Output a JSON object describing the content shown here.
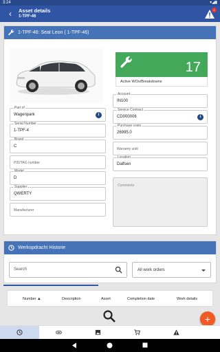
{
  "status_bar": {
    "time": "3:24",
    "right_text": "▾◢▮"
  },
  "app_bar": {
    "back_icon": "back-arrow-icon",
    "title": "Asset details",
    "subtitle": "1-TPF-46",
    "warning_badge": "1"
  },
  "asset_card": {
    "header": "1-TPF-46: Seat Leon ( 1-TPF-46)",
    "open_workorders": {
      "count": "17",
      "label": "Active WOs/Breakdowns",
      "color": "#44a85a"
    },
    "left_fields": [
      {
        "label": "Part of",
        "value": "Wagenpark",
        "info": true
      },
      {
        "label": "Serial Number",
        "value": "1-TPF-4",
        "info": false
      },
      {
        "label": "Brand",
        "value": "C",
        "info": false
      },
      {
        "label": "",
        "value": "",
        "placeholder": "PID/TAG number",
        "info": false
      },
      {
        "label": "Model",
        "value": "D",
        "info": false
      },
      {
        "label": "Supplier",
        "value": "QWERTY",
        "info": false
      },
      {
        "label": "",
        "value": "",
        "placeholder": "Manufacturer",
        "info": false
      }
    ],
    "right_fields": [
      {
        "label": "Account",
        "value": "IN100",
        "info": false
      },
      {
        "label": "Service Contract",
        "value": "CD000006",
        "info": true
      },
      {
        "label": "Purchase costs",
        "value": "26995.0",
        "info": false
      },
      {
        "label": "",
        "value": "",
        "placeholder": "Warranty until",
        "info": false
      },
      {
        "label": "Location",
        "value": "Dalfsen",
        "info": false
      }
    ],
    "comments_placeholder": "Comments"
  },
  "history": {
    "header": "Werkopdracht Historie",
    "search_placeholder": "Search",
    "filter_value": "All work orders",
    "columns": [
      "Number ▲",
      "Description",
      "Asset",
      "Completion date",
      "Work details"
    ]
  },
  "fab_label": "+",
  "colors": {
    "primary": "#2f55a4",
    "header": "#4672b8",
    "accent": "#f25a25"
  }
}
